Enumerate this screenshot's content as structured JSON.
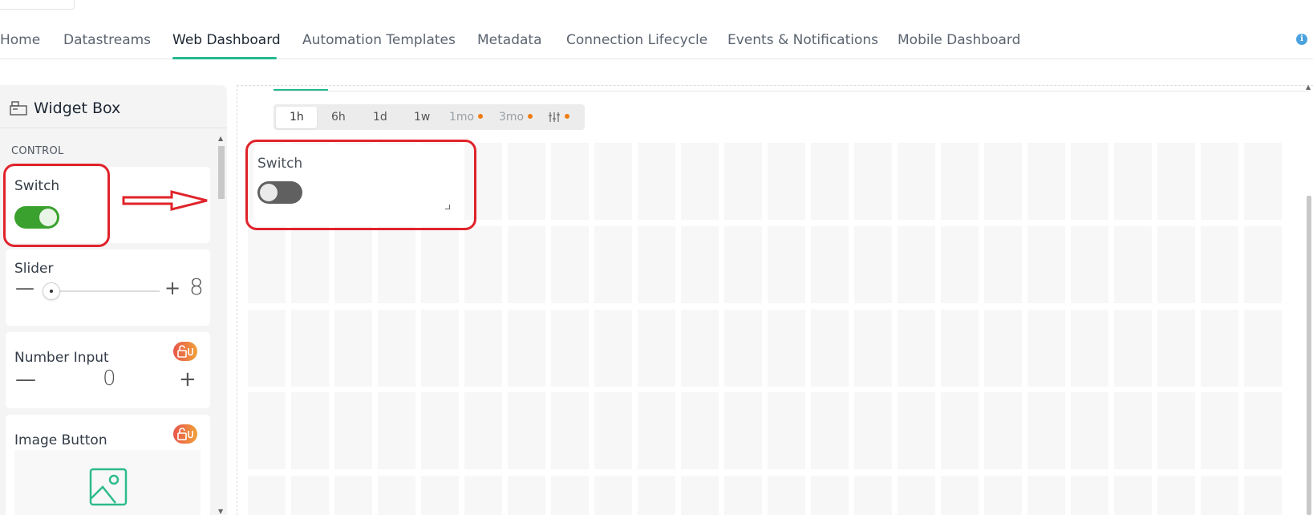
{
  "tabs": [
    {
      "label": "Home",
      "active": false
    },
    {
      "label": "Datastreams",
      "active": false
    },
    {
      "label": "Web Dashboard",
      "active": true
    },
    {
      "label": "Automation Templates",
      "active": false
    },
    {
      "label": "Metadata",
      "active": false
    },
    {
      "label": "Connection Lifecycle",
      "active": false
    },
    {
      "label": "Events & Notifications",
      "active": false
    },
    {
      "label": "Mobile Dashboard",
      "active": false
    }
  ],
  "info_icon": "info-icon",
  "widget_box": {
    "title": "Widget Box",
    "icon": "widget-box-icon",
    "section": "CONTROL",
    "widgets": {
      "switch": {
        "label": "Switch",
        "state": "on"
      },
      "slider": {
        "label": "Slider",
        "minus": "—",
        "plus": "+",
        "value": "8"
      },
      "number_input": {
        "label": "Number Input",
        "minus": "—",
        "plus": "+",
        "value": "0",
        "locked": true
      },
      "image_button": {
        "label": "Image Button",
        "locked": true
      }
    }
  },
  "time_ranges": [
    {
      "label": "1h",
      "active": true,
      "premium": false
    },
    {
      "label": "6h",
      "active": false,
      "premium": false
    },
    {
      "label": "1d",
      "active": false,
      "premium": false
    },
    {
      "label": "1w",
      "active": false,
      "premium": false
    },
    {
      "label": "1mo",
      "active": false,
      "premium": true
    },
    {
      "label": "3mo",
      "active": false,
      "premium": true
    },
    {
      "label": "custom-range-icon",
      "active": false,
      "premium": true
    }
  ],
  "dashboard_widget": {
    "label": "Switch",
    "state": "off"
  },
  "colors": {
    "accent": "#23b990",
    "switch_on": "#3aa12e",
    "switch_off": "#606060",
    "annotation": "#e0232a",
    "premium_dot": "#f07d10"
  }
}
